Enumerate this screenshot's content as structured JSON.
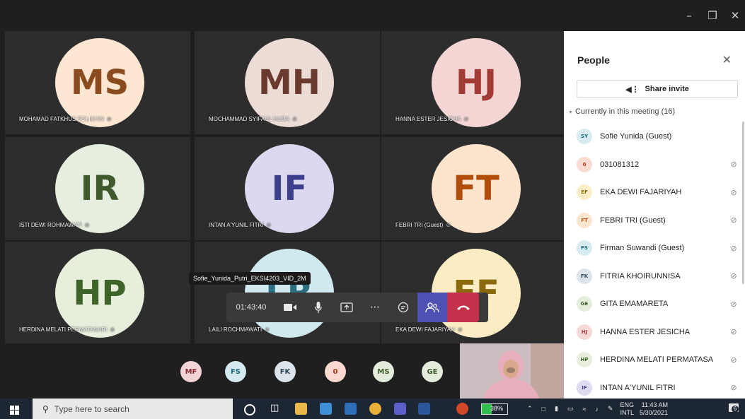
{
  "window": {
    "minimize_icon": "minimize-icon",
    "maximize_icon": "maximize-icon",
    "close_icon": "close-icon"
  },
  "tiles": [
    {
      "initials": "MS",
      "name": "MOHAMAD FATKHUS SOLIKHIN",
      "bg": "#fde7d3",
      "fg": "#8a4b1f"
    },
    {
      "initials": "MH",
      "name": "MOCHAMMAD SYIFAUL HUDA",
      "bg": "#ecdcd6",
      "fg": "#6b3a2e"
    },
    {
      "initials": "HJ",
      "name": "HANNA ESTER JESICHA",
      "bg": "#f3d6d3",
      "fg": "#a23a35"
    },
    {
      "initials": "IR",
      "name": "ISTI DEWI ROHMAWATI",
      "bg": "#e6eedf",
      "fg": "#3f5a2c"
    },
    {
      "initials": "IF",
      "name": "INTAN A'YUNIL FITRI",
      "bg": "#dcd8ef",
      "fg": "#3c3f8a"
    },
    {
      "initials": "FT",
      "name": "FEBRI TRI (Guest)",
      "bg": "#fde4cd",
      "fg": "#b24e0c"
    },
    {
      "initials": "HP",
      "name": "HERDINA MELATI PERMATASARI",
      "bg": "#e7efdc",
      "fg": "#3f6429"
    },
    {
      "initials": "LR",
      "name": "LAILI ROCHMAWATI",
      "bg": "#cfe9ee",
      "fg": "#2b6f80"
    },
    {
      "initials": "EF",
      "name": "EKA DEWI FAJARIYAH",
      "bg": "#fbecc4",
      "fg": "#8a6a0c"
    }
  ],
  "tooltip": "Sofie_Yunida_Putri_EKSI4203_VID_2M",
  "controls": {
    "timer": "01:43:40",
    "camera_icon": "video-camera-icon",
    "mic_icon": "microphone-icon",
    "share_icon": "share-screen-icon",
    "more_icon": "more-options-icon",
    "chat_icon": "chat-icon",
    "people_icon": "people-icon",
    "hangup_icon": "hang-up-icon"
  },
  "bottom_avatars": [
    {
      "initials": "MF",
      "bg": "#f2d4d6",
      "fg": "#8a2b32"
    },
    {
      "initials": "FS",
      "bg": "#d4eaf0",
      "fg": "#1f6a7d"
    },
    {
      "initials": "FK",
      "bg": "#dbe4ea",
      "fg": "#2c4a5a"
    },
    {
      "initials": "0",
      "bg": "#f9d8cf",
      "fg": "#b23a1f"
    },
    {
      "initials": "MS",
      "bg": "#e3ebdc",
      "fg": "#425f2f"
    },
    {
      "initials": "GE",
      "bg": "#e4ecdb",
      "fg": "#3d5a2a"
    }
  ],
  "panel": {
    "title": "People",
    "close_icon": "close-icon",
    "share_invite": "Share invite",
    "section": "Currently in this meeting (16)",
    "people": [
      {
        "initials": "SY",
        "name": "Sofie Yunida (Guest)",
        "bg": "#d6ecf1",
        "fg": "#1f6a7d",
        "muted": false
      },
      {
        "initials": "0",
        "name": "031081312",
        "bg": "#fbdcd2",
        "fg": "#b23a1f",
        "muted": true
      },
      {
        "initials": "EF",
        "name": "EKA DEWI FAJARIYAH",
        "bg": "#fcefc8",
        "fg": "#8a6a0c",
        "muted": true
      },
      {
        "initials": "FT",
        "name": "FEBRI TRI (Guest)",
        "bg": "#fde6cf",
        "fg": "#b24e0c",
        "muted": true
      },
      {
        "initials": "FS",
        "name": "Firman Suwandi (Guest)",
        "bg": "#d6ecf1",
        "fg": "#1f6a7d",
        "muted": true
      },
      {
        "initials": "FK",
        "name": "FITRIA KHOIRUNNISA",
        "bg": "#dde5eb",
        "fg": "#2c4a5a",
        "muted": true
      },
      {
        "initials": "GE",
        "name": "GITA EMAMARETA",
        "bg": "#e5eddc",
        "fg": "#3d5a2a",
        "muted": true
      },
      {
        "initials": "HJ",
        "name": "HANNA ESTER JESICHA",
        "bg": "#f6d8d6",
        "fg": "#a23a35",
        "muted": true
      },
      {
        "initials": "HP",
        "name": "HERDINA MELATI PERMATASA",
        "bg": "#e7efdc",
        "fg": "#3f6429",
        "muted": true
      },
      {
        "initials": "IF",
        "name": "INTAN A'YUNIL FITRI",
        "bg": "#dedaf0",
        "fg": "#3c3f8a",
        "muted": true
      }
    ]
  },
  "taskbar": {
    "search_placeholder": "Type here to search",
    "battery": "38%",
    "lang": "ENG",
    "lang2": "INTL",
    "time": "11:43 AM",
    "date": "5/30/2021",
    "notif_count": "6"
  }
}
